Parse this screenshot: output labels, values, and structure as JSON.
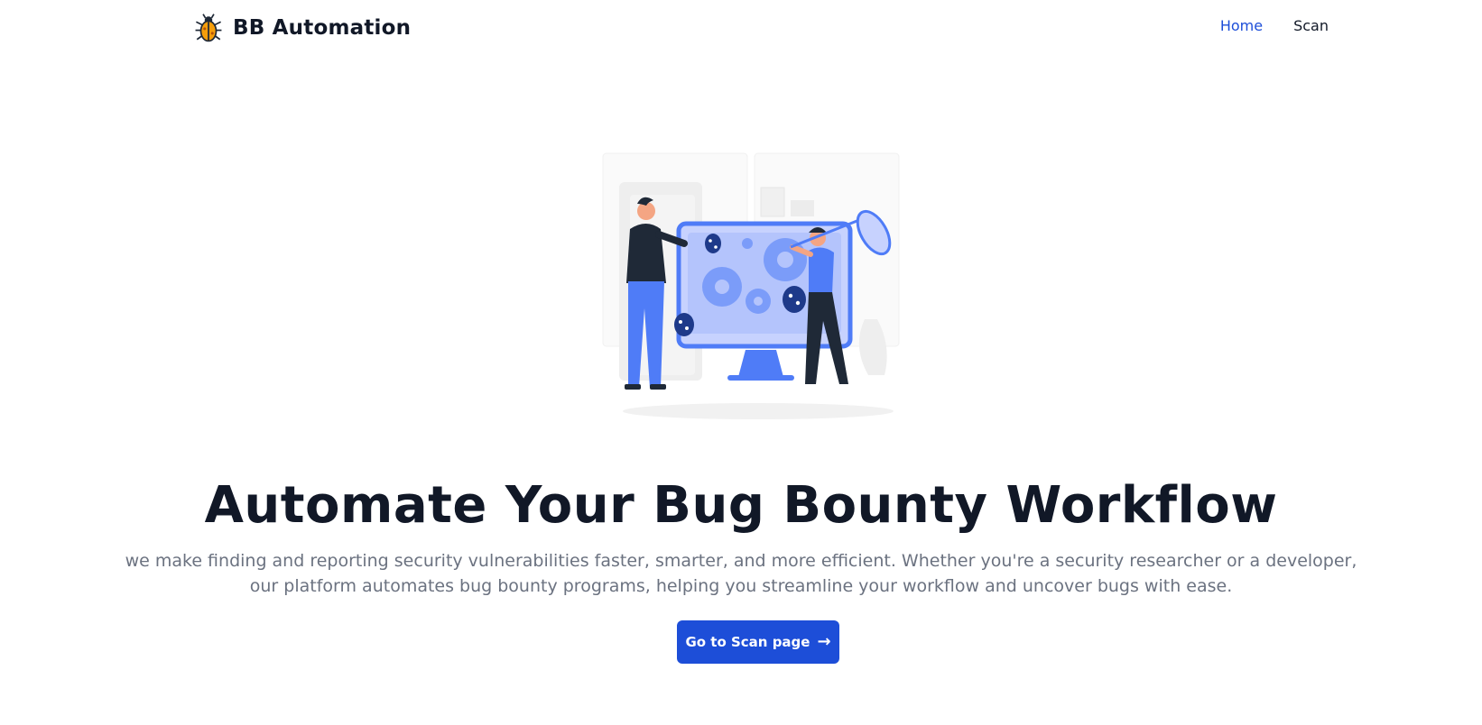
{
  "brand": {
    "name": "BB Automation",
    "logo_icon": "bug-icon",
    "logo_color": "#f59e0b"
  },
  "nav": {
    "items": [
      {
        "label": "Home",
        "active": true
      },
      {
        "label": "Scan",
        "active": false
      }
    ]
  },
  "hero": {
    "illustration": "bug-hunting-illustration",
    "title": "Automate Your Bug Bounty Workflow",
    "description": "we make finding and reporting security vulnerabilities faster, smarter, and more efficient. Whether you're a security researcher or a developer, our platform automates bug bounty programs, helping you streamline your workflow and uncover bugs with ease.",
    "cta_label": "Go to Scan page",
    "cta_icon": "arrow-right-icon"
  },
  "colors": {
    "accent": "#1d4ed8",
    "illustration_blue": "#4f7cf7",
    "text_dark": "#111827",
    "text_muted": "#6b7280"
  }
}
